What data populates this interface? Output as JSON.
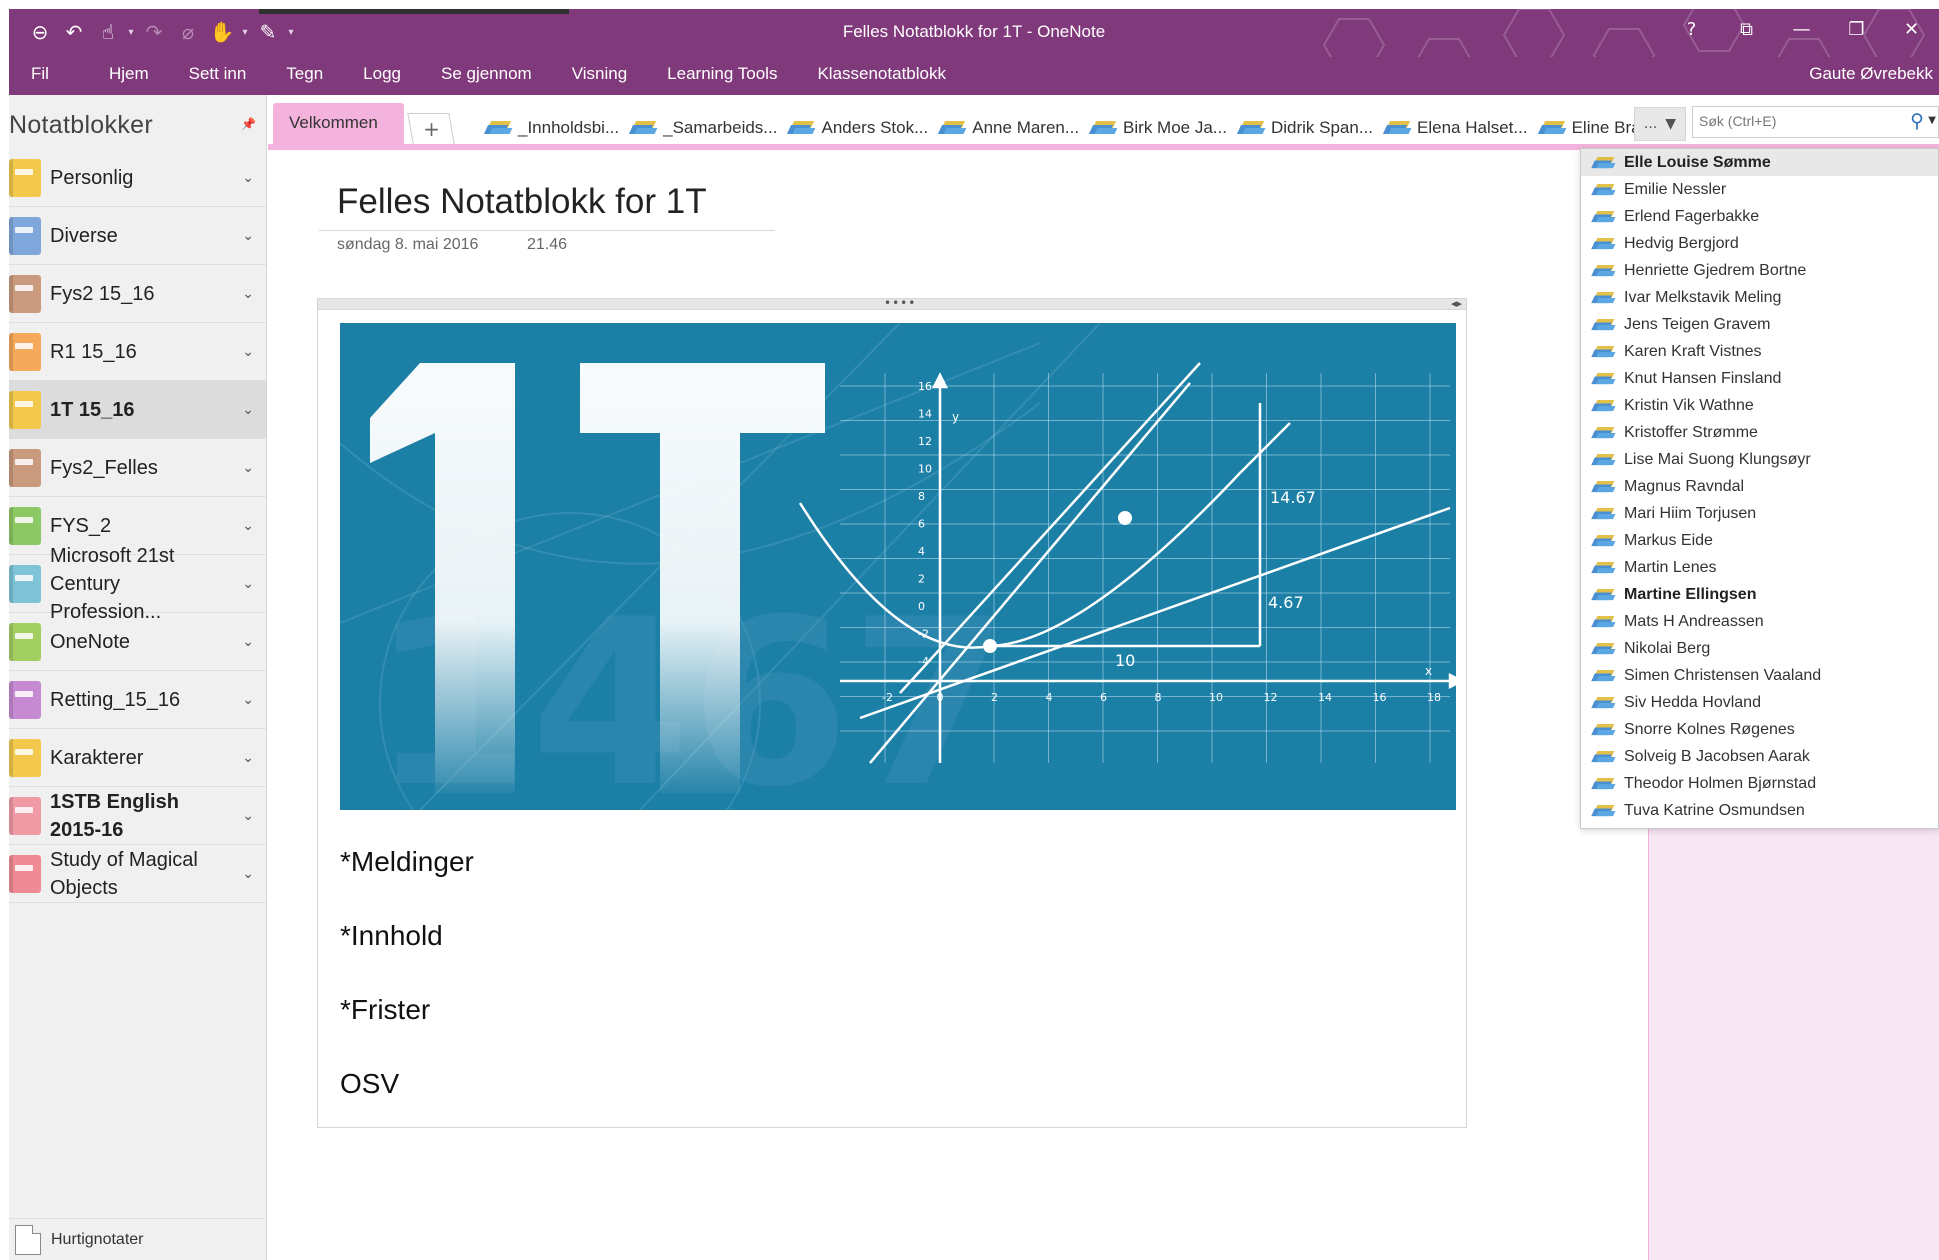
{
  "window": {
    "title": "Felles Notatblokk for 1T - OneNote",
    "controls": [
      "?",
      "⧉",
      "—",
      "❐",
      "✕"
    ]
  },
  "quick_access": {
    "icons": [
      "back-icon",
      "undo-icon",
      "touch-mode-icon",
      "redo-icon",
      "attach-icon",
      "hand-icon",
      "pen-icon",
      "customize-icon"
    ]
  },
  "ribbon": {
    "tabs": [
      "Fil",
      "Hjem",
      "Sett inn",
      "Tegn",
      "Logg",
      "Se gjennom",
      "Visning",
      "Learning Tools",
      "Klassenotatblokk"
    ],
    "user": "Gaute Øvrebekk"
  },
  "notebooks": {
    "header": "Notatblokker",
    "items": [
      {
        "label": "Personlig",
        "color": "#f2c94c"
      },
      {
        "label": "Diverse",
        "color": "#7fa7dc"
      },
      {
        "label": "Fys2 15_16",
        "color": "#c99a7d"
      },
      {
        "label": "R1 15_16",
        "color": "#f5a95a"
      },
      {
        "label": "1T 15_16",
        "color": "#f2c94c",
        "active": true
      },
      {
        "label": "Fys2_Felles",
        "color": "#c99a7d"
      },
      {
        "label": "FYS_2",
        "color": "#8cc965"
      },
      {
        "label": "Microsoft 21st Century Profession...",
        "color": "#7fc3d9"
      },
      {
        "label": "OneNote",
        "color": "#a3cf62"
      },
      {
        "label": "Retting_15_16",
        "color": "#c58ad2"
      },
      {
        "label": "Karakterer",
        "color": "#f2c94c"
      },
      {
        "label": "1STB English 2015-16",
        "color": "#f09aa6",
        "bold": true
      },
      {
        "label": "Study of Magical Objects",
        "color": "#ef8b94"
      }
    ],
    "quick_notes": "Hurtignotater"
  },
  "sections": {
    "active": "Velkommen",
    "add": "+",
    "groups": [
      "_Innholdsbi...",
      "_Samarbeids...",
      "Anders Stok...",
      "Anne Maren...",
      "Birk Moe Ja...",
      "Didrik Span...",
      "Elena Halset...",
      "Eline Brand..."
    ],
    "more": "...",
    "search_placeholder": "Søk (Ctrl+E)"
  },
  "page": {
    "title": "Felles Notatblokk for 1T",
    "date": "søndag 8. mai 2016",
    "time": "21.46",
    "lines": [
      "*Meldinger",
      "*Innhold",
      "*Frister",
      "OSV"
    ],
    "banner": {
      "big_text": "1T",
      "labels": {
        "top": "14.67",
        "mid": "4.67",
        "bottom": "10",
        "axis_y": "y",
        "axis_x": "x"
      },
      "y_ticks": [
        "16",
        "14",
        "12",
        "10",
        "8",
        "6",
        "4",
        "2",
        "0",
        "-2",
        "-4"
      ],
      "x_ticks": [
        "-2",
        "0",
        "2",
        "4",
        "6",
        "8",
        "10",
        "12",
        "14",
        "16",
        "18"
      ]
    }
  },
  "dropdown": {
    "items": [
      {
        "label": "Elle Louise Sømme",
        "bold": true,
        "highlight": true
      },
      {
        "label": "Emilie Nessler"
      },
      {
        "label": "Erlend Fagerbakke"
      },
      {
        "label": "Hedvig Bergjord"
      },
      {
        "label": "Henriette Gjedrem Bortne"
      },
      {
        "label": "Ivar Melkstavik Meling"
      },
      {
        "label": "Jens Teigen Gravem"
      },
      {
        "label": "Karen Kraft Vistnes"
      },
      {
        "label": "Knut Hansen Finsland"
      },
      {
        "label": "Kristin Vik Wathne"
      },
      {
        "label": "Kristoffer Strømme"
      },
      {
        "label": "Lise Mai Suong Klungsøyr"
      },
      {
        "label": "Magnus Ravndal"
      },
      {
        "label": "Mari Hiim Torjusen"
      },
      {
        "label": "Markus Eide"
      },
      {
        "label": "Martin Lenes"
      },
      {
        "label": "Martine Ellingsen",
        "bold": true
      },
      {
        "label": "Mats H Andreassen"
      },
      {
        "label": "Nikolai Berg"
      },
      {
        "label": "Simen Christensen Vaaland"
      },
      {
        "label": "Siv Hedda Hovland"
      },
      {
        "label": "Snorre Kolnes Røgenes"
      },
      {
        "label": "Solveig B Jacobsen Aarak"
      },
      {
        "label": "Theodor Holmen Bjørnstad"
      },
      {
        "label": "Tuva Katrine Osmundsen"
      }
    ]
  },
  "colors": {
    "ribbon": "#80397b",
    "section_accent": "#f3b3dc",
    "banner": "#1c7fa6"
  }
}
